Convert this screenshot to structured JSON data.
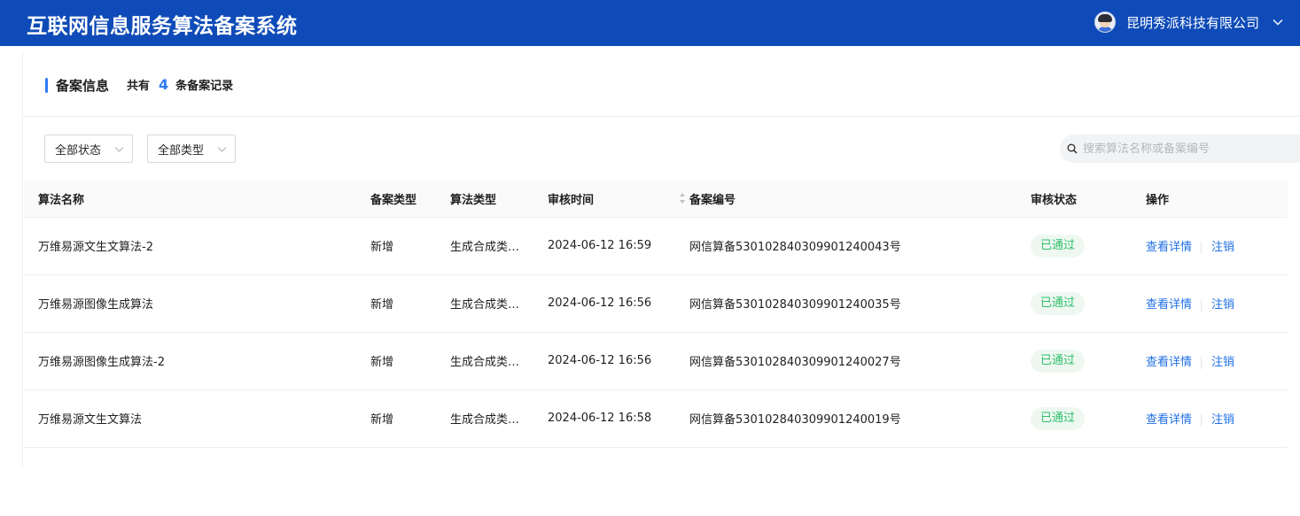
{
  "header": {
    "app_title": "互联网信息服务算法备案系统",
    "company_name": "昆明秀派科技有限公司",
    "brand_color": "#0f4bb8"
  },
  "section": {
    "title": "备案信息",
    "count_prefix": "共有",
    "count": "4",
    "count_suffix": "条备案记录"
  },
  "filters": {
    "status_select": "全部状态",
    "type_select": "全部类型",
    "search_placeholder": "搜索算法名称或备案编号"
  },
  "table": {
    "columns": [
      "算法名称",
      "备案类型",
      "算法类型",
      "审核时间",
      "备案编号",
      "审核状态",
      "操作"
    ],
    "rows": [
      {
        "name": "万维易源文生文算法-2",
        "filing_type": "新增",
        "algo_type": "生成合成类算法",
        "time": "2024-06-12 16:59",
        "number": "网信算备530102840309901240043号",
        "status": "已通过",
        "action_detail": "查看详情",
        "action_cancel": "注销"
      },
      {
        "name": "万维易源图像生成算法",
        "filing_type": "新增",
        "algo_type": "生成合成类算法",
        "time": "2024-06-12 16:56",
        "number": "网信算备530102840309901240035号",
        "status": "已通过",
        "action_detail": "查看详情",
        "action_cancel": "注销"
      },
      {
        "name": "万维易源图像生成算法-2",
        "filing_type": "新增",
        "algo_type": "生成合成类算法",
        "time": "2024-06-12 16:56",
        "number": "网信算备530102840309901240027号",
        "status": "已通过",
        "action_detail": "查看详情",
        "action_cancel": "注销"
      },
      {
        "name": "万维易源文生文算法",
        "filing_type": "新增",
        "algo_type": "生成合成类算法",
        "time": "2024-06-12 16:58",
        "number": "网信算备530102840309901240019号",
        "status": "已通过",
        "action_detail": "查看详情",
        "action_cancel": "注销"
      }
    ]
  },
  "colors": {
    "accent": "#2f7bf5",
    "link": "#1f6fe5",
    "status_success": "#2fbf6a"
  }
}
